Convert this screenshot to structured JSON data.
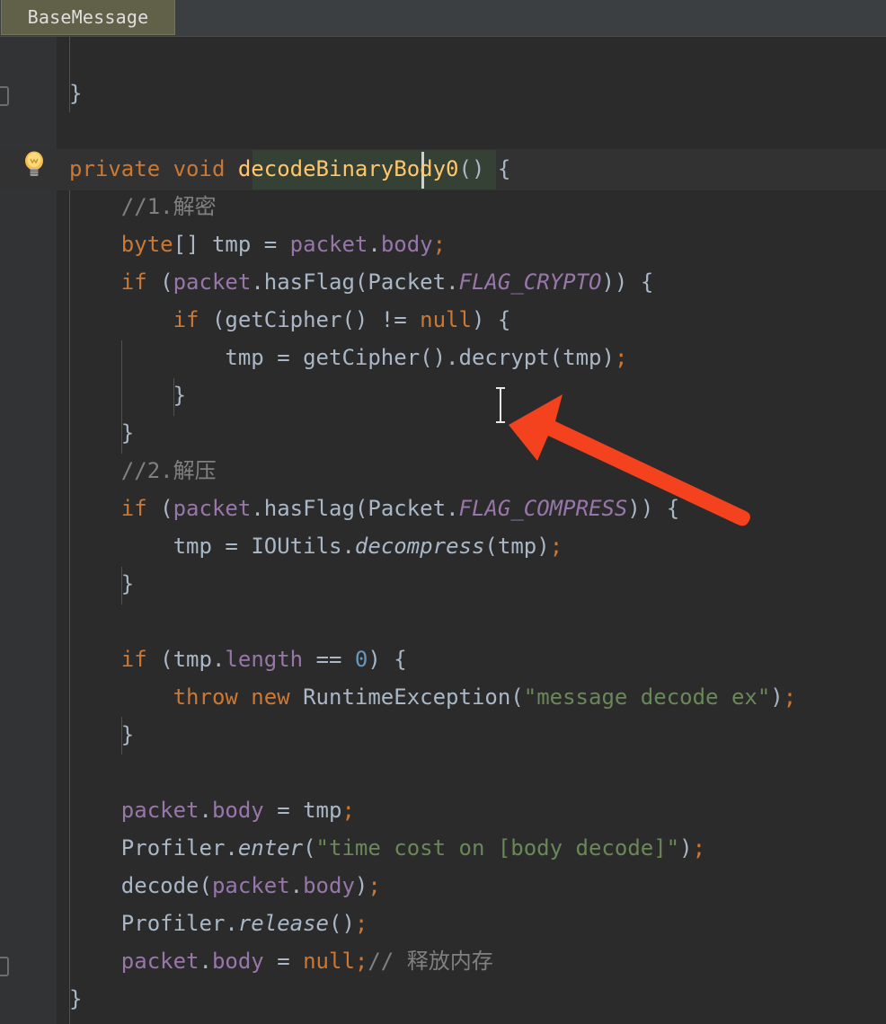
{
  "window": {
    "app": "IntelliJ IDEA Java editor",
    "background_color": "#2b2b2b"
  },
  "tabstrip": {
    "active_tab": "BaseMessage",
    "tab_background_color": "#61614a",
    "strip_background_color": "#3c3f41"
  },
  "gutter": {
    "bulb_icon": "lightbulb-icon",
    "marker_icons": [
      "implementing-method-icon",
      "implementing-method-icon",
      "implementing-method-icon"
    ]
  },
  "editor": {
    "caret_position_text": "decodeBinary|Body0",
    "highlighted_identifier": "decodeBinaryBody0",
    "caret_line_color": "#323232",
    "identifier_highlight_color": "#344134",
    "font_size_px": 24,
    "line_height_px": 42
  },
  "annotation": {
    "arrow_color": "#f4411e",
    "arrow_from": "815,528",
    "arrow_to": "566,432",
    "mouse_cursor": "text-ibeam-cursor"
  },
  "code": {
    "language": "Java",
    "lines": [
      {
        "indent": 0,
        "tokens": [
          {
            "t": "}",
            "c": "br"
          }
        ]
      },
      {
        "indent": 0,
        "tokens": []
      },
      {
        "indent": 0,
        "tokens": [
          {
            "t": "private",
            "c": "kw"
          },
          {
            "t": " ",
            "c": "pn"
          },
          {
            "t": "void",
            "c": "kw"
          },
          {
            "t": " ",
            "c": "pn"
          },
          {
            "t": "decodeBinaryBody0",
            "c": "fn"
          },
          {
            "t": "()",
            "c": "pn"
          },
          {
            "t": " ",
            "c": "pn"
          },
          {
            "t": "{",
            "c": "br"
          }
        ]
      },
      {
        "indent": 1,
        "tokens": [
          {
            "t": "//1.解密",
            "c": "cmt"
          }
        ]
      },
      {
        "indent": 1,
        "tokens": [
          {
            "t": "byte",
            "c": "kw"
          },
          {
            "t": "[] ",
            "c": "pn"
          },
          {
            "t": "tmp",
            "c": "var"
          },
          {
            "t": " = ",
            "c": "op"
          },
          {
            "t": "packet",
            "c": "fld"
          },
          {
            "t": ".",
            "c": "pn"
          },
          {
            "t": "body",
            "c": "fld"
          },
          {
            "t": ";",
            "c": "kw"
          }
        ]
      },
      {
        "indent": 1,
        "tokens": [
          {
            "t": "if",
            "c": "kw"
          },
          {
            "t": " (",
            "c": "pn"
          },
          {
            "t": "packet",
            "c": "fld"
          },
          {
            "t": ".",
            "c": "pn"
          },
          {
            "t": "hasFlag",
            "c": "var"
          },
          {
            "t": "(",
            "c": "pn"
          },
          {
            "t": "Packet",
            "c": "cls"
          },
          {
            "t": ".",
            "c": "pn"
          },
          {
            "t": "FLAG_CRYPTO",
            "c": "sfld"
          },
          {
            "t": ")) ",
            "c": "pn"
          },
          {
            "t": "{",
            "c": "br"
          }
        ]
      },
      {
        "indent": 2,
        "tokens": [
          {
            "t": "if",
            "c": "kw"
          },
          {
            "t": " (",
            "c": "pn"
          },
          {
            "t": "getCipher",
            "c": "var"
          },
          {
            "t": "() != ",
            "c": "op"
          },
          {
            "t": "null",
            "c": "kw"
          },
          {
            "t": ") ",
            "c": "pn"
          },
          {
            "t": "{",
            "c": "br"
          }
        ]
      },
      {
        "indent": 3,
        "tokens": [
          {
            "t": "tmp",
            "c": "var"
          },
          {
            "t": " = ",
            "c": "op"
          },
          {
            "t": "getCipher",
            "c": "var"
          },
          {
            "t": "().",
            "c": "pn"
          },
          {
            "t": "decrypt",
            "c": "var"
          },
          {
            "t": "(",
            "c": "pn"
          },
          {
            "t": "tmp",
            "c": "var"
          },
          {
            "t": ")",
            "c": "pn"
          },
          {
            "t": ";",
            "c": "kw"
          }
        ]
      },
      {
        "indent": 2,
        "tokens": [
          {
            "t": "}",
            "c": "br"
          }
        ]
      },
      {
        "indent": 1,
        "tokens": [
          {
            "t": "}",
            "c": "br"
          }
        ]
      },
      {
        "indent": 1,
        "tokens": [
          {
            "t": "//2.解压",
            "c": "cmt"
          }
        ]
      },
      {
        "indent": 1,
        "tokens": [
          {
            "t": "if",
            "c": "kw"
          },
          {
            "t": " (",
            "c": "pn"
          },
          {
            "t": "packet",
            "c": "fld"
          },
          {
            "t": ".",
            "c": "pn"
          },
          {
            "t": "hasFlag",
            "c": "var"
          },
          {
            "t": "(",
            "c": "pn"
          },
          {
            "t": "Packet",
            "c": "cls"
          },
          {
            "t": ".",
            "c": "pn"
          },
          {
            "t": "FLAG_COMPRESS",
            "c": "sfld"
          },
          {
            "t": ")) ",
            "c": "pn"
          },
          {
            "t": "{",
            "c": "br"
          }
        ]
      },
      {
        "indent": 2,
        "tokens": [
          {
            "t": "tmp",
            "c": "var"
          },
          {
            "t": " = ",
            "c": "op"
          },
          {
            "t": "IOUtils",
            "c": "cls"
          },
          {
            "t": ".",
            "c": "pn"
          },
          {
            "t": "decompress",
            "c": "smth"
          },
          {
            "t": "(",
            "c": "pn"
          },
          {
            "t": "tmp",
            "c": "var"
          },
          {
            "t": ")",
            "c": "pn"
          },
          {
            "t": ";",
            "c": "kw"
          }
        ]
      },
      {
        "indent": 1,
        "tokens": [
          {
            "t": "}",
            "c": "br"
          }
        ]
      },
      {
        "indent": 0,
        "tokens": []
      },
      {
        "indent": 1,
        "tokens": [
          {
            "t": "if",
            "c": "kw"
          },
          {
            "t": " (",
            "c": "pn"
          },
          {
            "t": "tmp",
            "c": "var"
          },
          {
            "t": ".",
            "c": "pn"
          },
          {
            "t": "length",
            "c": "fld"
          },
          {
            "t": " == ",
            "c": "op"
          },
          {
            "t": "0",
            "c": "num"
          },
          {
            "t": ") ",
            "c": "pn"
          },
          {
            "t": "{",
            "c": "br"
          }
        ]
      },
      {
        "indent": 2,
        "tokens": [
          {
            "t": "throw",
            "c": "kw"
          },
          {
            "t": " ",
            "c": "pn"
          },
          {
            "t": "new",
            "c": "kw"
          },
          {
            "t": " ",
            "c": "pn"
          },
          {
            "t": "RuntimeException",
            "c": "cls"
          },
          {
            "t": "(",
            "c": "pn"
          },
          {
            "t": "\"message decode ex\"",
            "c": "str"
          },
          {
            "t": ")",
            "c": "pn"
          },
          {
            "t": ";",
            "c": "kw"
          }
        ]
      },
      {
        "indent": 1,
        "tokens": [
          {
            "t": "}",
            "c": "br"
          }
        ]
      },
      {
        "indent": 0,
        "tokens": []
      },
      {
        "indent": 1,
        "tokens": [
          {
            "t": "packet",
            "c": "fld"
          },
          {
            "t": ".",
            "c": "pn"
          },
          {
            "t": "body",
            "c": "fld"
          },
          {
            "t": " = ",
            "c": "op"
          },
          {
            "t": "tmp",
            "c": "var"
          },
          {
            "t": ";",
            "c": "kw"
          }
        ]
      },
      {
        "indent": 1,
        "tokens": [
          {
            "t": "Profiler",
            "c": "cls"
          },
          {
            "t": ".",
            "c": "pn"
          },
          {
            "t": "enter",
            "c": "smth"
          },
          {
            "t": "(",
            "c": "pn"
          },
          {
            "t": "\"time cost on [body decode]\"",
            "c": "str"
          },
          {
            "t": ")",
            "c": "pn"
          },
          {
            "t": ";",
            "c": "kw"
          }
        ]
      },
      {
        "indent": 1,
        "tokens": [
          {
            "t": "decode",
            "c": "var"
          },
          {
            "t": "(",
            "c": "pn"
          },
          {
            "t": "packet",
            "c": "fld"
          },
          {
            "t": ".",
            "c": "pn"
          },
          {
            "t": "body",
            "c": "fld"
          },
          {
            "t": ")",
            "c": "pn"
          },
          {
            "t": ";",
            "c": "kw"
          }
        ]
      },
      {
        "indent": 1,
        "tokens": [
          {
            "t": "Profiler",
            "c": "cls"
          },
          {
            "t": ".",
            "c": "pn"
          },
          {
            "t": "release",
            "c": "smth"
          },
          {
            "t": "()",
            "c": "pn"
          },
          {
            "t": ";",
            "c": "kw"
          }
        ]
      },
      {
        "indent": 1,
        "tokens": [
          {
            "t": "packet",
            "c": "fld"
          },
          {
            "t": ".",
            "c": "pn"
          },
          {
            "t": "body",
            "c": "fld"
          },
          {
            "t": " = ",
            "c": "op"
          },
          {
            "t": "null",
            "c": "kw"
          },
          {
            "t": ";",
            "c": "kw"
          },
          {
            "t": "// 释放内存",
            "c": "cmt"
          }
        ]
      },
      {
        "indent": 0,
        "tokens": [
          {
            "t": "}",
            "c": "br"
          }
        ]
      }
    ]
  }
}
